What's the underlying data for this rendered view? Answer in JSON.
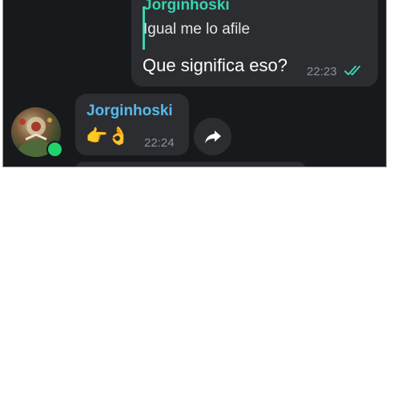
{
  "colors": {
    "background": "#18191d",
    "bubble": "#2b2d31",
    "reply_accent": "#3bd1b0",
    "sender_name": "#5ab8ea",
    "read_ticks": "#3bd1b0",
    "online": "#20d36a",
    "timestamp": "#8e9096"
  },
  "outgoing_message": {
    "reply_to_name": "Jorginhoski",
    "reply_to_text": "Igual me lo afile",
    "text": "Que significa eso?",
    "time": "22:23",
    "status_icon": "double-check-icon"
  },
  "incoming_message": {
    "sender_name": "Jorginhoski",
    "text": "👉👌",
    "time": "22:24",
    "avatar_online": true
  },
  "actions": {
    "share_icon": "share-arrow-icon"
  }
}
